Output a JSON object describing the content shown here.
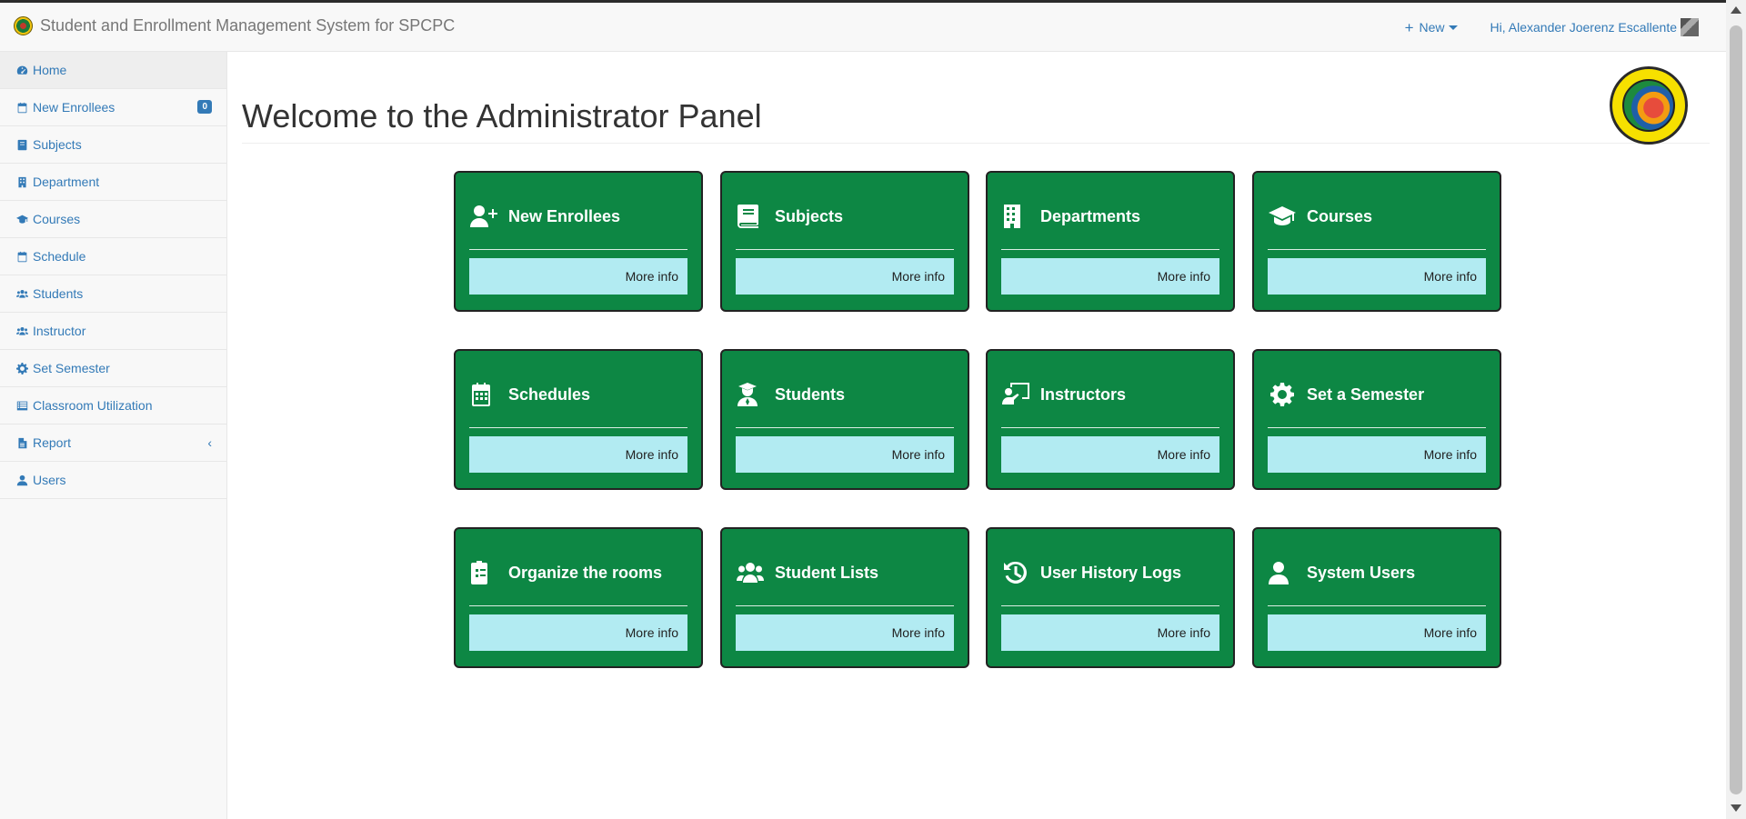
{
  "navbar": {
    "brand": "Student and Enrollment Management System for SPCPC",
    "new_label": "New",
    "user_greeting": "Hi, Alexander Joerenz Escallente"
  },
  "sidebar": {
    "items": [
      {
        "label": "Home",
        "icon": "dashboard-icon"
      },
      {
        "label": "New Enrollees",
        "icon": "calendar-icon",
        "badge": "0"
      },
      {
        "label": "Subjects",
        "icon": "book-icon"
      },
      {
        "label": "Department",
        "icon": "building-icon"
      },
      {
        "label": "Courses",
        "icon": "graduation-cap-icon"
      },
      {
        "label": "Schedule",
        "icon": "calendar-icon"
      },
      {
        "label": "Students",
        "icon": "users-icon"
      },
      {
        "label": "Instructor",
        "icon": "users-icon"
      },
      {
        "label": "Set Semester",
        "icon": "gear-icon"
      },
      {
        "label": "Classroom Utilization",
        "icon": "list-icon"
      },
      {
        "label": "Report",
        "icon": "file-icon"
      },
      {
        "label": "Users",
        "icon": "user-icon"
      }
    ]
  },
  "main": {
    "title": "Welcome to the Administrator Panel",
    "cards": [
      {
        "title": "New Enrollees",
        "more": "More info",
        "icon": "user-plus-icon"
      },
      {
        "title": "Subjects",
        "more": "More info",
        "icon": "book-icon"
      },
      {
        "title": "Departments",
        "more": "More info",
        "icon": "building-icon"
      },
      {
        "title": "Courses",
        "more": "More info",
        "icon": "graduation-cap-icon"
      },
      {
        "title": "Schedules",
        "more": "More info",
        "icon": "calendar-icon"
      },
      {
        "title": "Students",
        "more": "More info",
        "icon": "student-icon"
      },
      {
        "title": "Instructors",
        "more": "More info",
        "icon": "chalkboard-teacher-icon"
      },
      {
        "title": "Set a Semester",
        "more": "More info",
        "icon": "gear-icon"
      },
      {
        "title": "Organize the rooms",
        "more": "More info",
        "icon": "clipboard-list-icon"
      },
      {
        "title": "Student Lists",
        "more": "More info",
        "icon": "users-icon"
      },
      {
        "title": "User History Logs",
        "more": "More info",
        "icon": "history-icon"
      },
      {
        "title": "System Users",
        "more": "More info",
        "icon": "user-icon"
      }
    ]
  },
  "colors": {
    "card_bg": "#0d8744",
    "more_info_bg": "#b2ebf2",
    "link": "#337ab7"
  }
}
